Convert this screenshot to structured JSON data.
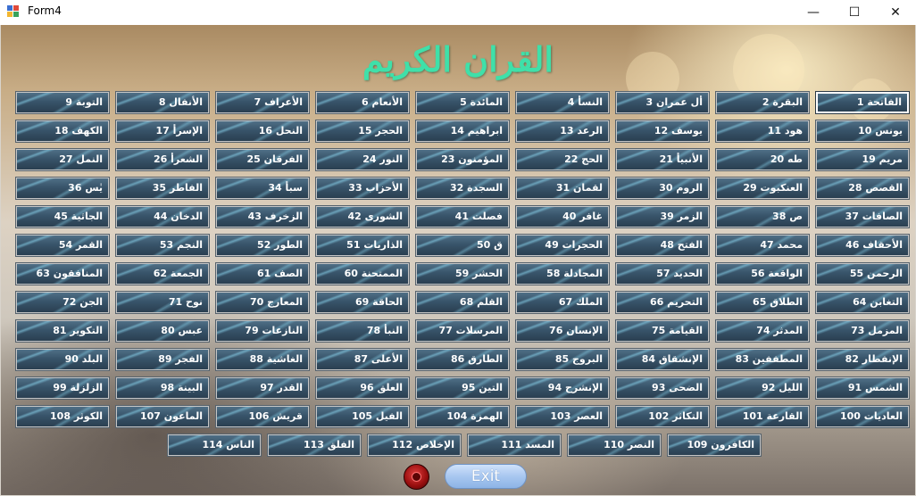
{
  "window": {
    "title": "Form4",
    "minimize_glyph": "—",
    "maximize_glyph": "☐",
    "close_glyph": "✕",
    "app_icon": "windows-form-icon"
  },
  "header": {
    "title": "القران الكريم"
  },
  "surahs": [
    "الفاتحة 1",
    "البقرة 2",
    "أل عمران 3",
    "النسأ 4",
    "المائدة 5",
    "الأنعام 6",
    "الأعراف 7",
    "الأنفال 8",
    "التوبة 9",
    "يونس 10",
    "هود 11",
    "يوسف 12",
    "الرعد 13",
    "ابراهيم 14",
    "الحجر 15",
    "النحل 16",
    "الإسرأ 17",
    "الكهف 18",
    "مريم 19",
    "طه 20",
    "الأنبيأ 21",
    "الحج 22",
    "المؤمنون 23",
    "النور 24",
    "الفرقان 25",
    "الشعرأ 26",
    "النمل 27",
    "القصص 28",
    "العنكبوت 29",
    "الروم 30",
    "لقمان 31",
    "السجدة 32",
    "الأحزاب 33",
    "سبأ 34",
    "الفاطر 35",
    "يٰس 36",
    "الصافات 37",
    "ص 38",
    "الزمر 39",
    "غافر 40",
    "فصلت 41",
    "الشورى 42",
    "الزخرف 43",
    "الدخان 44",
    "الجاثية 45",
    "الأحقاف 46",
    "محمد 47",
    "الفتح 48",
    "الحجرات 49",
    "ق 50",
    "الذاريات 51",
    "الطور 52",
    "النجم 53",
    "القمر 54",
    "الرحمن 55",
    "الواقعة 56",
    "الحديد 57",
    "المجادلة 58",
    "الحشر 59",
    "الممتحنة 60",
    "الصف 61",
    "الجمعة 62",
    "المنافقون 63",
    "التغابن 64",
    "الطلاق 65",
    "التحريم 66",
    "الملك 67",
    "القلم 68",
    "الحاقة 69",
    "المعارج 70",
    "نوح 71",
    "الجن 72",
    "المزمل 73",
    "المدثر 74",
    "القيامة 75",
    "الإنسان 76",
    "المرسلات 77",
    "النبأ 78",
    "النازعات 79",
    "عبس 80",
    "التكوير 81",
    "الإنفطار 82",
    "المطففين 83",
    "الإنشقاق 84",
    "البروج 85",
    "الطارق 86",
    "الأعلى 87",
    "الغاشية 88",
    "الفجر 89",
    "البلد 90",
    "الشمس 91",
    "الليل 92",
    "الضحى 93",
    "الإنشرح 94",
    "التين 95",
    "العلق 96",
    "القدر 97",
    "البينة 98",
    "الزلزلة 99",
    "العاديات 100",
    "القارعة 101",
    "التكاثر 102",
    "العصر 103",
    "الهمزة 104",
    "الفيل 105",
    "قريش 106",
    "الماعون 107",
    "الكوثر 108",
    "الكافرون 109",
    "النصر 110",
    "المسد 111",
    "الإخلاص 112",
    "الفلق 113",
    "الناس 114"
  ],
  "footer": {
    "exit_label": "Exit",
    "record_icon": "record-icon"
  }
}
